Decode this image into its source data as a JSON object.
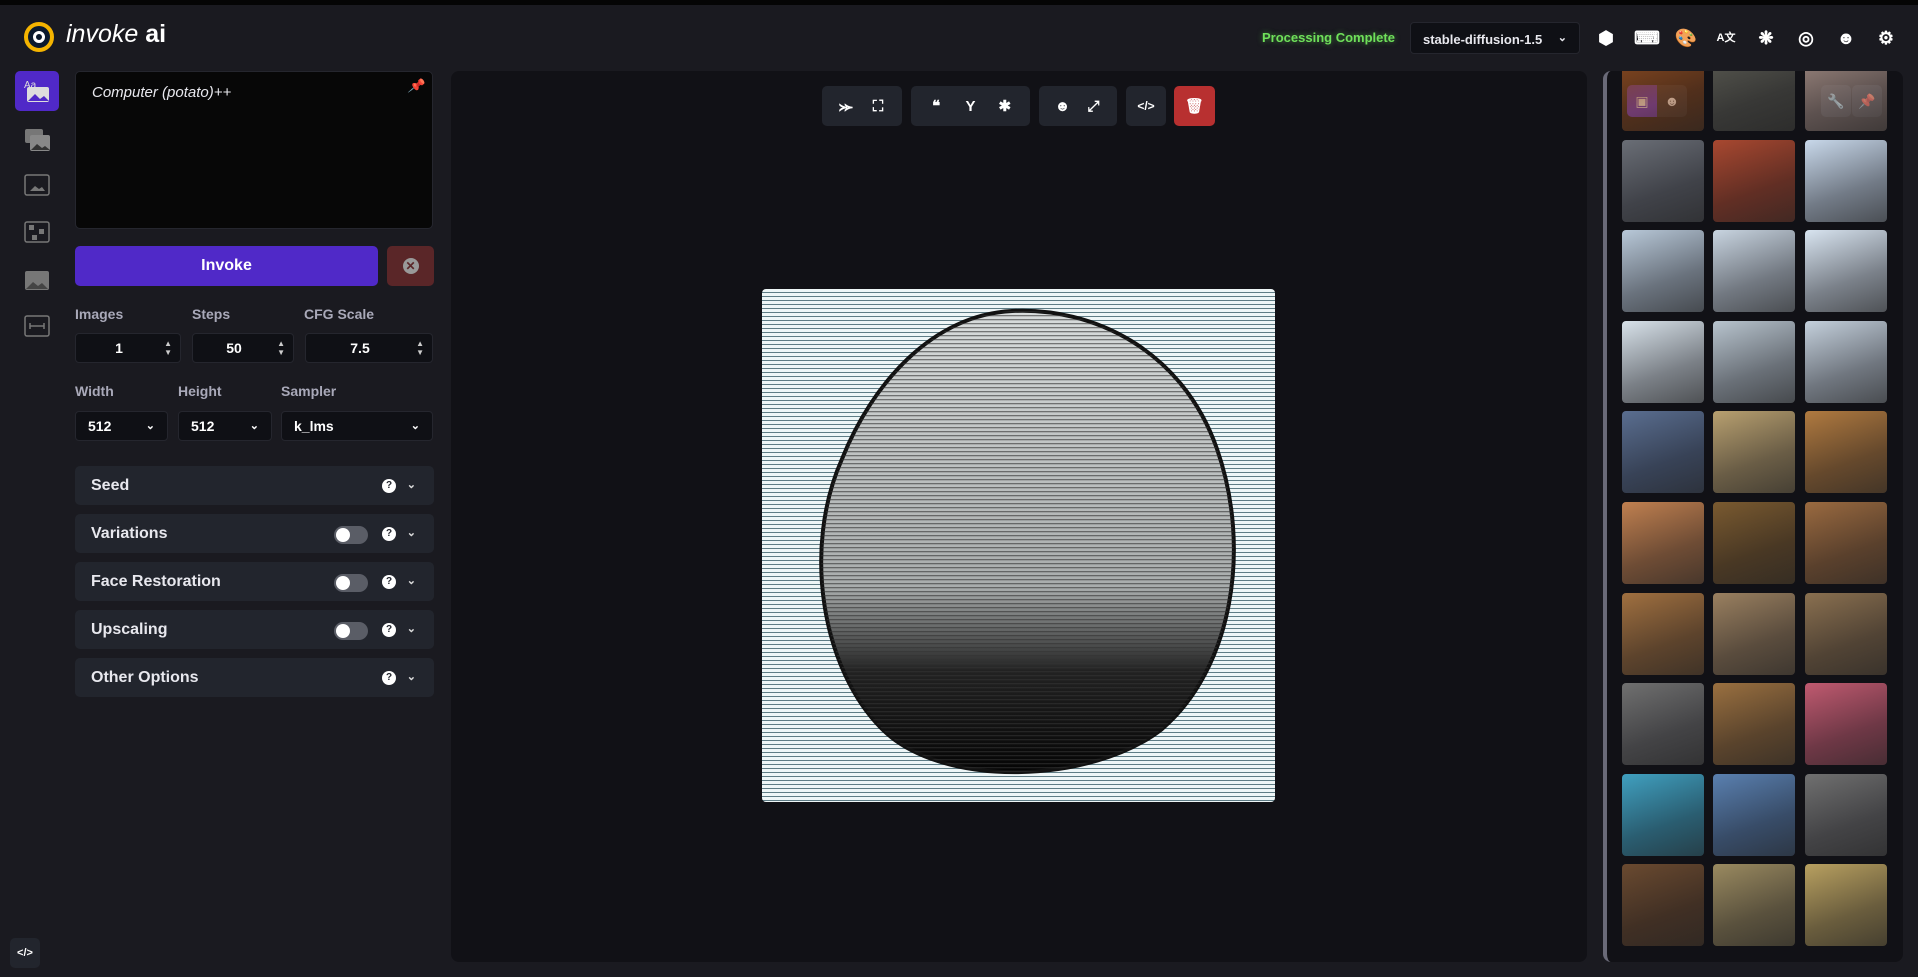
{
  "header": {
    "brand_light": "invoke",
    "brand_bold": "ai",
    "status": "Processing Complete",
    "model": "stable-diffusion-1.5"
  },
  "prompt": {
    "value": "Computer (potato)++"
  },
  "invoke_label": "Invoke",
  "params": {
    "images_label": "Images",
    "images": "1",
    "steps_label": "Steps",
    "steps": "50",
    "cfg_label": "CFG Scale",
    "cfg": "7.5",
    "width_label": "Width",
    "width": "512",
    "height_label": "Height",
    "height": "512",
    "sampler_label": "Sampler",
    "sampler": "k_lms"
  },
  "accordions": [
    {
      "label": "Seed",
      "toggle": false
    },
    {
      "label": "Variations",
      "toggle": true
    },
    {
      "label": "Face Restoration",
      "toggle": true
    },
    {
      "label": "Upscaling",
      "toggle": true
    },
    {
      "label": "Other Options",
      "toggle": false
    }
  ],
  "colors": {
    "accent": "#5029c8",
    "delete": "#b83030",
    "status": "#6fe05a"
  },
  "thumbnail_colors": [
    "#8a4a20",
    "#5a5a52",
    "#a08a82",
    "#6a6e76",
    "#a84830",
    "#c8d8ea",
    "#b8c8d8",
    "#c8d4e0",
    "#d8e4f0",
    "#d8e2ea",
    "#b8c4ce",
    "#c4d0dc",
    "#5a6e90",
    "#b8a070",
    "#b07a40",
    "#c08050",
    "#7a5a30",
    "#9a6a40",
    "#a07040",
    "#9a8060",
    "#8a7050",
    "#707070",
    "#9a7040",
    "#c05a70",
    "#40a0c0",
    "#5a80b0",
    "#707070",
    "#6a4a30",
    "#9a8a60",
    "#b8a060"
  ]
}
